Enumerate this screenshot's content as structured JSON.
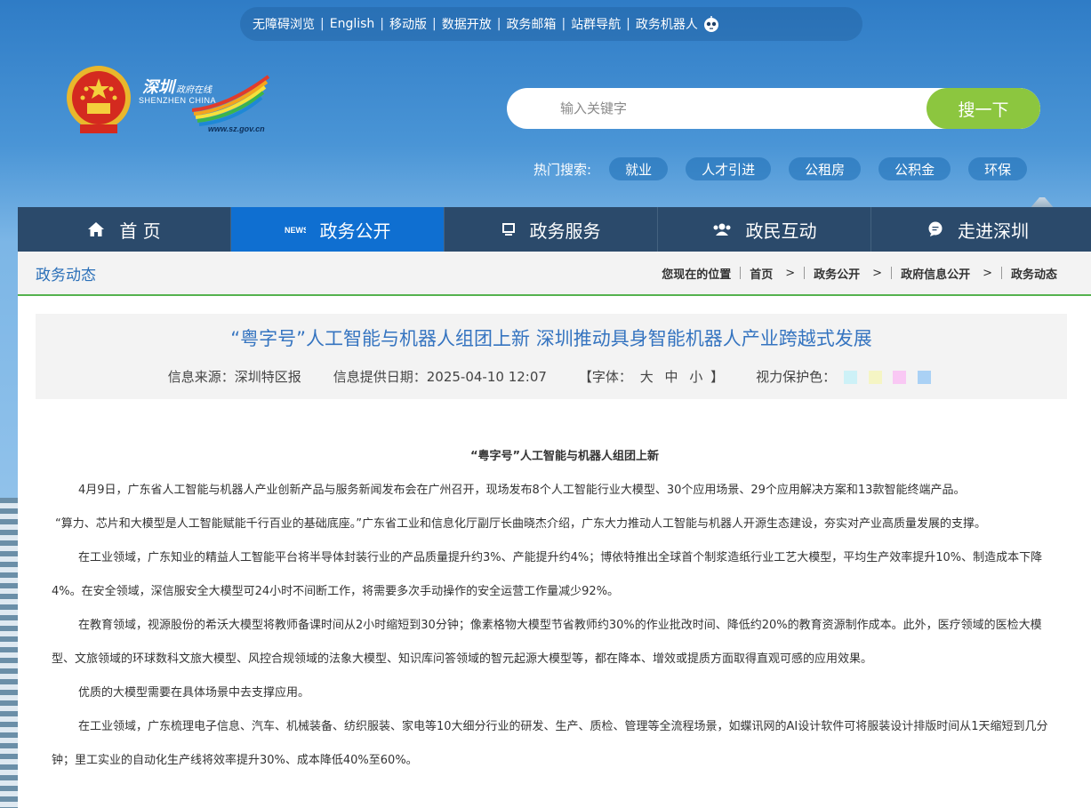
{
  "topbar": {
    "links": [
      "无障碍浏览",
      "English",
      "移动版",
      "数据开放",
      "政务邮箱",
      "站群导航",
      "政务机器人"
    ]
  },
  "logo": {
    "cn": "深圳",
    "cn_small": "政府在线",
    "en": "SHENZHEN  CHINA",
    "url": "www.sz.gov.cn"
  },
  "search": {
    "placeholder": "输入关键字",
    "button": "搜一下"
  },
  "hot_search": {
    "label": "热门搜索:",
    "tags": [
      "就业",
      "人才引进",
      "公租房",
      "公积金",
      "环保"
    ]
  },
  "nav": {
    "items": [
      {
        "label": "首 页",
        "icon": "home-icon"
      },
      {
        "label": "政务公开",
        "icon": "news-icon"
      },
      {
        "label": "政务服务",
        "icon": "monitor-icon"
      },
      {
        "label": "政民互动",
        "icon": "users-icon"
      },
      {
        "label": "走进深圳",
        "icon": "chat-icon"
      }
    ],
    "active_index": 1
  },
  "section_title": "政务动态",
  "breadcrumb": {
    "location_label": "您现在的位置",
    "items": [
      "首页",
      "政务公开",
      "政府信息公开",
      "政务动态"
    ]
  },
  "article": {
    "title": "“粤字号”人工智能与机器人组团上新 深圳推动具身智能机器人产业跨越式发展",
    "source": "信息来源：深圳特区报",
    "date": "信息提供日期：2025-04-10 12:07",
    "font_label_open": "【字体：",
    "font_sizes": [
      "大",
      "中",
      "小"
    ],
    "font_label_close": "】",
    "eye_label": "视力保护色：",
    "eye_colors": [
      "#cdf1f7",
      "#f5f5c4",
      "#f9c8f4",
      "#aad1f5"
    ],
    "subhead": "“粤字号”人工智能与机器人组团上新",
    "paragraphs": [
      "4月9日，广东省人工智能与机器人产业创新产品与服务新闻发布会在广州召开，现场发布8个人工智能行业大模型、30个应用场景、29个应用解决方案和13款智能终端产品。",
      "“算力、芯片和大模型是人工智能赋能千行百业的基础底座。”广东省工业和信息化厅副厅长曲晓杰介绍，广东大力推动人工智能与机器人开源生态建设，夯实对产业高质量发展的支撑。",
      "在工业领域，广东知业的精益人工智能平台将半导体封装行业的产品质量提升约3%、产能提升约4%；博依特推出全球首个制浆造纸行业工艺大模型，平均生产效率提升10%、制造成本下降4%。在安全领域，深信服安全大模型可24小时不间断工作，将需要多次手动操作的安全运营工作量减少92%。",
      "在教育领域，视源股份的希沃大模型将教师备课时间从2小时缩短到30分钟；像素格物大模型节省教师约30%的作业批改时间、降低约20%的教育资源制作成本。此外，医疗领域的医检大模型、文旅领域的环球数科文旅大模型、风控合规领域的法象大模型、知识库问答领域的智元起源大模型等，都在降本、增效或提质方面取得直观可感的应用效果。",
      "优质的大模型需要在具体场景中去支撑应用。",
      "在工业领域，广东梳理电子信息、汽车、机械装备、纺织服装、家电等10大细分行业的研发、生产、质检、管理等全流程场景，如蝶讯网的AI设计软件可将服装设计排版时间从1天缩短到几分钟；里工实业的自动化生产线将效率提升30%、成本降低40%至60%。"
    ]
  }
}
